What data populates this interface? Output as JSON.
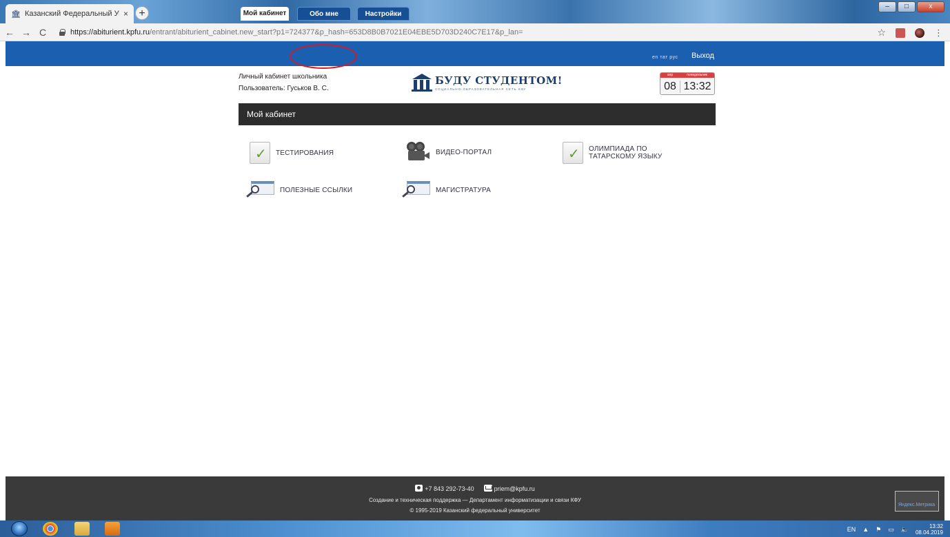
{
  "browser": {
    "tab_title": "Казанский Федеральный Униве",
    "tab_close": "×",
    "new_tab": "+",
    "url_host": "https://abiturient.kpfu.ru",
    "url_path": "/entrant/abiturient_cabinet.new_start?p1=724377&p_hash=653D8B0B7021E04EBE5D703D240C7E17&p_lan=",
    "nav_back": "←",
    "nav_forward": "→",
    "nav_reload": "C",
    "star": "☆",
    "menu": "⋮"
  },
  "window_controls": {
    "minimize": "–",
    "maximize": "□",
    "close": "x"
  },
  "nav": {
    "tabs": [
      {
        "label": "Мой кабинет"
      },
      {
        "label": "Обо мне"
      },
      {
        "label": "Настройки"
      }
    ],
    "languages": "en тат рус",
    "logout": "Выход"
  },
  "header": {
    "cabinet_kind": "Личный кабинет школьника",
    "user_line": "Пользователь: Гуськов В. С.",
    "logo_title": "БУДУ СТУДЕНТОМ!",
    "logo_subtitle": "СОЦИАЛЬНО-ОБРАЗОВАТЕЛЬНАЯ СЕТЬ КФУ"
  },
  "calendar": {
    "month": "апр",
    "weekday": "понедельник",
    "day": "08",
    "time": "13:32"
  },
  "section": {
    "title": "Мой кабинет"
  },
  "menu": [
    {
      "label": "ТЕСТИРОВАНИЯ",
      "icon": "check-icon"
    },
    {
      "label": "ВИДЕО-ПОРТАЛ",
      "icon": "camera-icon"
    },
    {
      "label_line1": "ОЛИМПИАДА ПО",
      "label_line2": "ТАТАРСКОМУ ЯЗЫКУ",
      "icon": "check-icon"
    },
    {
      "label": "ПОЛЕЗНЫЕ ССЫЛКИ",
      "icon": "search-icon"
    },
    {
      "label": "МАГИСТРАТУРА",
      "icon": "search-icon"
    }
  ],
  "footer": {
    "phone": "+7 843 292-73-40",
    "email": "priem@kpfu.ru",
    "support": "Создание и техническая поддержка — Департамент информатизации и связи КФУ",
    "copyright": "© 1995-2019 Казанский федеральный университет",
    "counter_alt": "Яндекс.Метрика"
  },
  "taskbar": {
    "lang": "EN",
    "clock_time": "13:32",
    "clock_date": "08.04.2019"
  },
  "colors": {
    "nav_blue": "#1b5fb0",
    "section_dark": "#2d2d2d",
    "footer_dark": "#3a3a3a",
    "highlight_ring": "#d11a2a",
    "logo_navy": "#1c3e6e"
  }
}
